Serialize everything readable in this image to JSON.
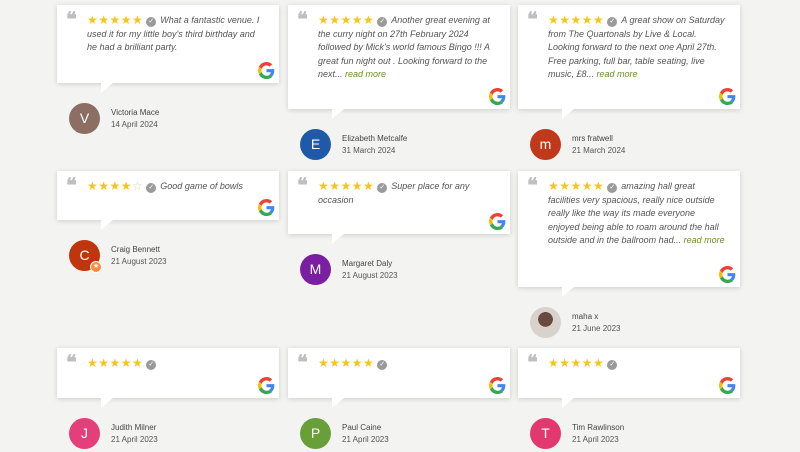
{
  "reviews": [
    {
      "text": "What a fantastic venue. I used it for my little boy's third birthday and he had a brilliant party.",
      "read_more": "",
      "name": "Victoria Mace",
      "date": "14 April 2024",
      "initial": "V",
      "avatar_color": "#8d6e63",
      "stars": 5
    },
    {
      "text": "Another great evening at the curry night on 27th February 2024 followed by Mick's world famous Bingo !!! A great fun night out . Looking forward to the next...",
      "read_more": "read more",
      "name": "Elizabeth Metcalfe",
      "date": "31 March 2024",
      "initial": "E",
      "avatar_color": "#1e5aa8",
      "stars": 5
    },
    {
      "text": "A great show on Saturday from The Quartonals by Live & Local. Looking forward to the next one April 27th. Free parking, full bar, table seating, live music, £8...",
      "read_more": "read more",
      "name": "mrs fratwell",
      "date": "21 March 2024",
      "initial": "m",
      "avatar_color": "#c0391b",
      "stars": 5
    },
    {
      "text": "Good game of bowls",
      "read_more": "",
      "name": "Craig Bennett",
      "date": "21 August 2023",
      "initial": "C",
      "avatar_color": "#bf360c",
      "stars": 4
    },
    {
      "text": "Super place for any occasion",
      "read_more": "",
      "name": "Margaret Daly",
      "date": "21 August 2023",
      "initial": "M",
      "avatar_color": "#7b1fa2",
      "stars": 5
    },
    {
      "text": "amazing hall great facilities very spacious, really nice outside really like the way its made everyone enjoyed being able to roam around the hall outside and in the ballroom had...",
      "read_more": "read more",
      "name": "maha x",
      "date": "21 June 2023",
      "initial": "",
      "avatar_color": "#d9d2cc",
      "stars": 5
    },
    {
      "text": "",
      "read_more": "",
      "name": "Judith Milner",
      "date": "21 April 2023",
      "initial": "J",
      "avatar_color": "#e43f7a",
      "stars": 5
    },
    {
      "text": "",
      "read_more": "",
      "name": "Paul Caine",
      "date": "21 April 2023",
      "initial": "P",
      "avatar_color": "#689f38",
      "stars": 5
    },
    {
      "text": "",
      "read_more": "",
      "name": "Tim Rawlinson",
      "date": "21 April 2023",
      "initial": "T",
      "avatar_color": "#e0386f",
      "stars": 5
    }
  ],
  "icons": {
    "quote": "quote-icon",
    "verified": "verified-check-icon",
    "source": "google-g-icon"
  }
}
